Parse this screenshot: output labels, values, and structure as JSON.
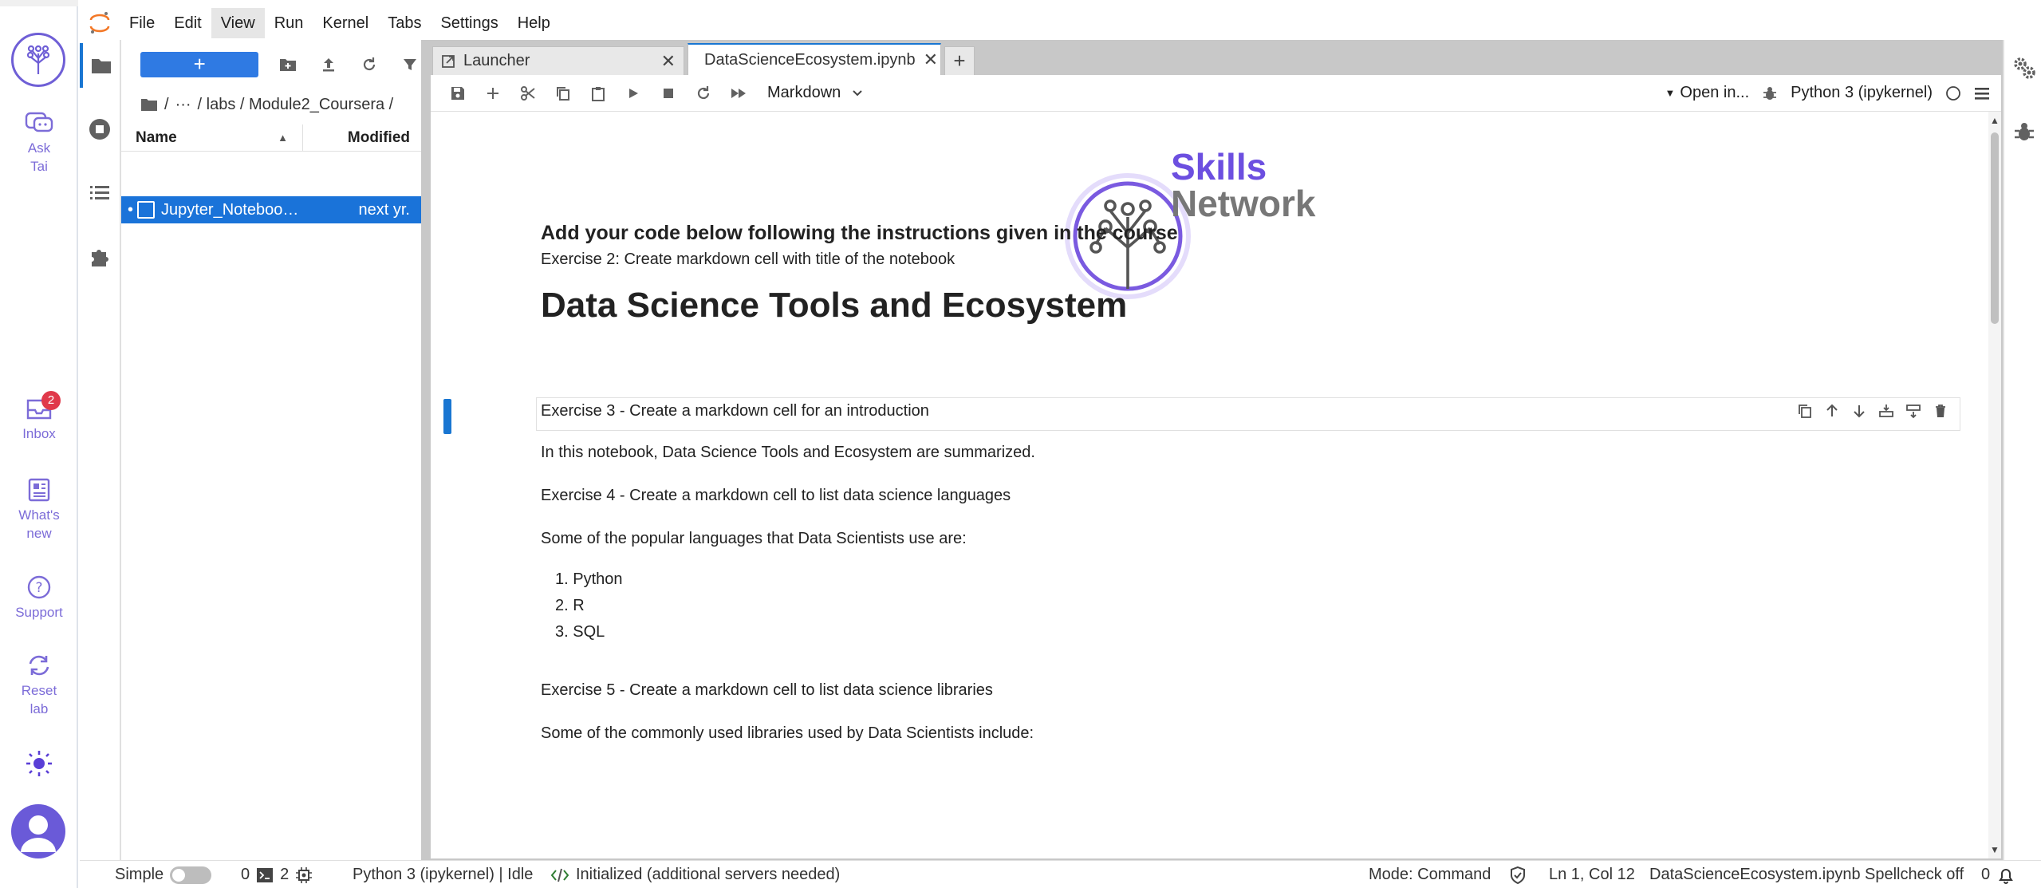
{
  "sidebar_rail": {
    "ask": "Ask\nTai",
    "inbox": {
      "label": "Inbox",
      "count": "2"
    },
    "whats_new": "What's\nnew",
    "support": "Support",
    "reset": "Reset\nlab"
  },
  "menubar": {
    "items": [
      "File",
      "Edit",
      "View",
      "Run",
      "Kernel",
      "Tabs",
      "Settings",
      "Help"
    ],
    "active": "View"
  },
  "filebrowser": {
    "new_label": "+",
    "breadcrumb": [
      "/",
      "···",
      "/ labs / Module2_Coursera /"
    ],
    "columns": {
      "name": "Name",
      "modified": "Modified"
    },
    "files": [
      {
        "name": "Jupyter_Notebook...",
        "modified": "next yr."
      }
    ]
  },
  "tabs": {
    "launcher": "Launcher",
    "notebook": "DataScienceEcosystem.ipynb",
    "add": "+"
  },
  "nb_toolbar": {
    "cell_type": "Markdown",
    "open_in": "Open in...",
    "kernel": "Python 3 (ipykernel)"
  },
  "notebook": {
    "brand1": "Skills",
    "brand2": "Network",
    "heading": "Add your code below following the instructions given in the course",
    "ex2": "Exercise 2: Create markdown cell with title of the notebook",
    "title": "Data Science Tools and Ecosystem",
    "ex3": "Exercise 3 - Create a markdown cell for an introduction",
    "intro": "In this notebook, Data Science Tools and Ecosystem are summarized.",
    "ex4": "Exercise 4 - Create a markdown cell to list data science languages",
    "langs_intro": "Some of the popular languages that Data Scientists use are:",
    "languages": [
      "1. Python",
      "2. R",
      "3. SQL"
    ],
    "ex5": "Exercise 5 - Create a markdown cell to list data science libraries",
    "libs_intro": "Some of the commonly used libraries used by Data Scientists include:"
  },
  "statusbar": {
    "mode_simple": "Simple",
    "terminals": "0",
    "kernels": "2",
    "kernel_status": "Python 3 (ipykernel) | Idle",
    "lsp": "Initialized (additional servers needed)",
    "mode": "Mode: Command",
    "position": "Ln 1, Col 12",
    "file": "DataScienceEcosystem.ipynb",
    "spellcheck": "Spellcheck off",
    "notifications": "0"
  },
  "colors": {
    "accent": "#1976d2",
    "brand_purple": "#6c4fe0",
    "selection": "#1a73d9"
  }
}
